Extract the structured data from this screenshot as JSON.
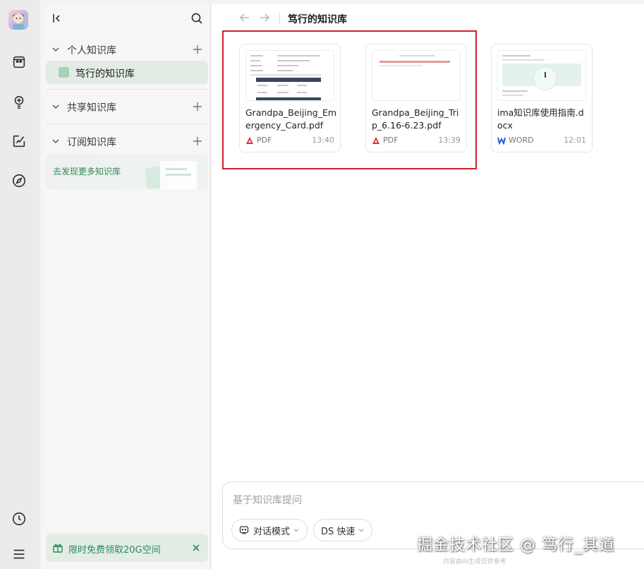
{
  "sidebar": {
    "sections": [
      {
        "label": "个人知识库"
      },
      {
        "label": "共享知识库"
      },
      {
        "label": "订阅知识库"
      }
    ],
    "active_kb": "笃行的知识库",
    "discover_text": "去发现更多知识库",
    "promo_text": "限时免费领取20G空间"
  },
  "header": {
    "title": "笃行的知识库"
  },
  "files": [
    {
      "name": "Grandpa_Beijing_Emergency_Card.pdf",
      "type": "PDF",
      "time": "13:40",
      "type_icon": "pdf-icon"
    },
    {
      "name": "Grandpa_Beijing_Trip_6.16-6.23.pdf",
      "type": "PDF",
      "time": "13:39",
      "type_icon": "pdf-icon"
    },
    {
      "name": "ima知识库使用指南.docx",
      "type": "WORD",
      "time": "12:01",
      "type_icon": "word-icon"
    }
  ],
  "composer": {
    "placeholder": "基于知识库提问",
    "mode_label": "对话模式",
    "model_label": "DS 快速",
    "disclaimer": "内容由AI生成仅供参考"
  },
  "watermark": "掘金技术社区 @ 笃行_其道",
  "colors": {
    "accent_green": "#2b8a55",
    "pdf_red": "#e5283a",
    "word_blue": "#2b5bd7",
    "highlight_red": "#d0202a"
  }
}
